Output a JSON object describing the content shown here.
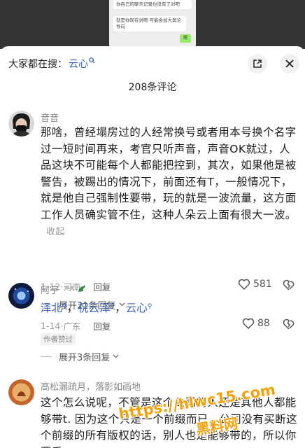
{
  "chat_preview": {
    "bubble1": "你自己的聊天记录也没有了对吧",
    "bubble2": "就是你现在说呢 可能会加大舆论导向",
    "green_label": "嗯"
  },
  "header": {
    "search_prefix": "大家都在搜：",
    "search_keyword": "云心",
    "comment_count": "208条评论"
  },
  "comments": [
    {
      "username": "音音",
      "text": "那啥，曾经塌房过的人经常换号或者用本号换个名字过一短时间再来，考官只听声音，声音OK就过，人品这块不可能每个人都能把控到，其次，如果他是被警告，被踢出的情况下，前面还有T，一般情况下，就是他自己强制性要带，玩的就是一波流量，这方面工作人员确实管不住，这种人朵云上面有很大一波。",
      "collapse_label": "收起",
      "date": "1-12",
      "location": "河南",
      "reply_label": "回复",
      "likes": "581",
      "expand_label": "展开21条回复"
    },
    {
      "username": "阿宇",
      "keywords": [
        "泽北",
        "祝云泽",
        "云心"
      ],
      "date": "1-14",
      "location": "广东",
      "reply_label": "回复",
      "likes": "88",
      "badge": "作者赞过",
      "expand_label": "展开3条回复"
    },
    {
      "username": "高松漏疏月，落影如画地",
      "text": "这个怎么说呢，不管是这个公司的人还是其他人都能够带t. 因为这个只是一个前缀而已，公司没有买断这个前缀的所有版权的话，别人也是能够带的，所以你要看"
    }
  ],
  "watermark": {
    "line1": "https://hlwc15.com",
    "line2": "黑料网"
  },
  "colors": {
    "keyword_blue": "#3a64b4",
    "watermark_orange": "#f5a20a"
  }
}
